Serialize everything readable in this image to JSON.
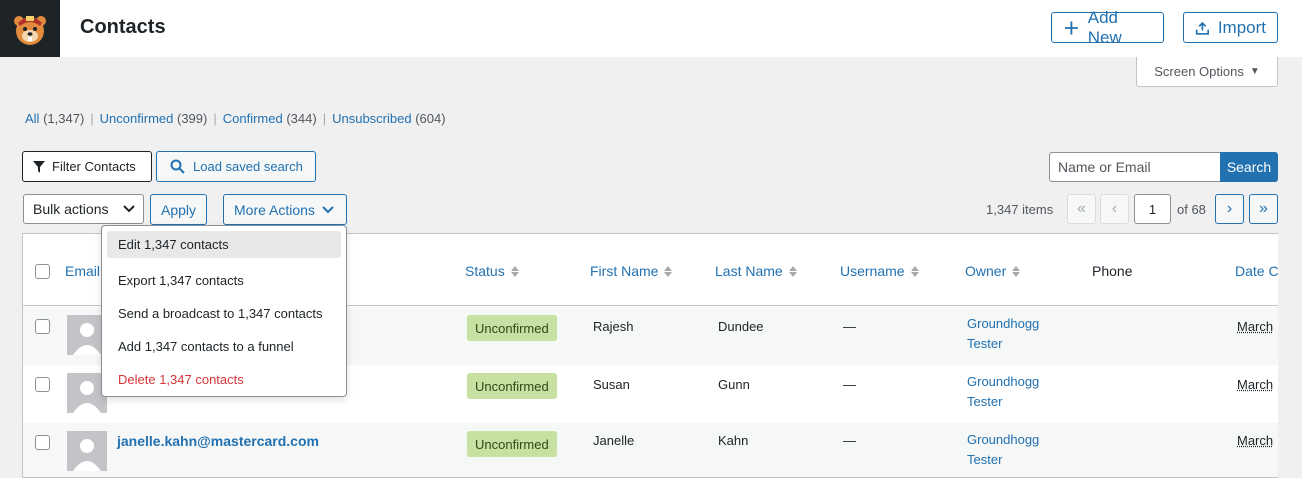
{
  "header": {
    "title": "Contacts",
    "add_new_label": "Add New",
    "import_label": "Import"
  },
  "screen_options_label": "Screen Options",
  "views": [
    {
      "label": "All",
      "count": "(1,347)"
    },
    {
      "label": "Unconfirmed",
      "count": "(399)"
    },
    {
      "label": "Confirmed",
      "count": "(344)"
    },
    {
      "label": "Unsubscribed",
      "count": "(604)"
    }
  ],
  "toolbar": {
    "filter_label": "Filter Contacts",
    "load_search_label": "Load saved search",
    "bulk_actions_label": "Bulk actions",
    "apply_label": "Apply",
    "more_actions_label": "More Actions",
    "search_placeholder": "Name or Email",
    "search_button_label": "Search"
  },
  "pagination": {
    "items": "1,347 items",
    "first": "«",
    "prev": "‹",
    "current_page": "1",
    "of_label": "of 68",
    "next": "›",
    "last": "»"
  },
  "table": {
    "columns": {
      "email": "Email",
      "status": "Status",
      "first_name": "First Name",
      "last_name": "Last Name",
      "username": "Username",
      "owner": "Owner",
      "phone": "Phone",
      "date": "Date C"
    },
    "rows": [
      {
        "email": "",
        "status": "Unconfirmed",
        "first_name": "Rajesh",
        "last_name": "Dundee",
        "username": "—",
        "owner_line1": "Groundhogg",
        "owner_line2": "Tester",
        "date": "March"
      },
      {
        "email": "",
        "status": "Unconfirmed",
        "first_name": "Susan",
        "last_name": "Gunn",
        "username": "—",
        "owner_line1": "Groundhogg",
        "owner_line2": "Tester",
        "date": "March"
      },
      {
        "email": "janelle.kahn@mastercard.com",
        "status": "Unconfirmed",
        "first_name": "Janelle",
        "last_name": "Kahn",
        "username": "—",
        "owner_line1": "Groundhogg",
        "owner_line2": "Tester",
        "date": "March"
      }
    ]
  },
  "more_actions_menu": [
    "Edit 1,347 contacts",
    "Export 1,347 contacts",
    "Send a broadcast to 1,347 contacts",
    "Add 1,347 contacts to a funnel",
    "Delete 1,347 contacts"
  ],
  "colors": {
    "accent": "#2271b1",
    "danger": "#d63638",
    "badge_unconfirmed": "#c6e1a2",
    "background": "#f0f0f1"
  }
}
